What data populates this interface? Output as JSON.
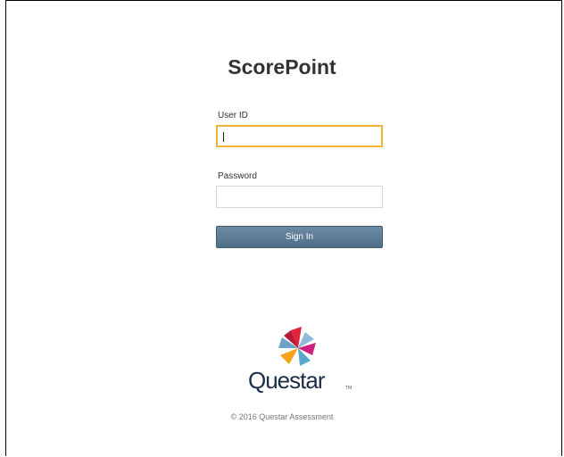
{
  "app": {
    "title": "ScorePoint"
  },
  "login_form": {
    "user_id_label": "User ID",
    "user_id_value": "",
    "password_label": "Password",
    "password_value": "",
    "sign_in_label": "Sign In"
  },
  "brand": {
    "logo_text": "Questar",
    "logo_icon": "questar-pinwheel-logo",
    "colors": [
      "#e1223b",
      "#d01f7e",
      "#6aa2c8",
      "#f7a21b",
      "#58a6cc",
      "#1c2d4a"
    ]
  },
  "footer": {
    "copyright": "© 2016 Questar Assessment"
  },
  "theme": {
    "button_color": "#5a7a93",
    "focus_border": "#f2b233"
  }
}
